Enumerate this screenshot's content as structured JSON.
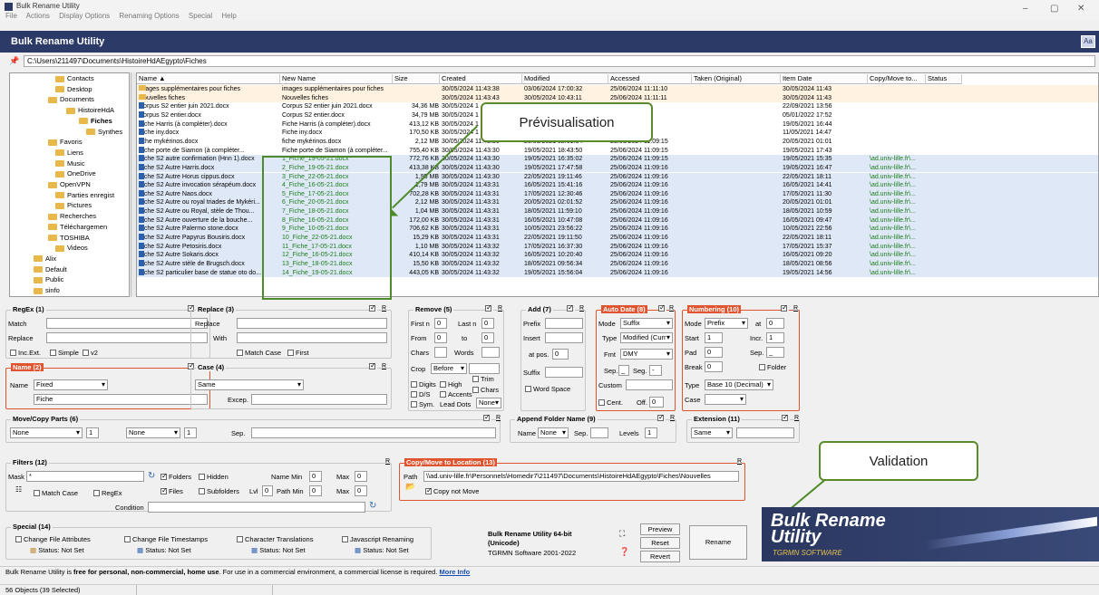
{
  "window": {
    "title": "Bulk Rename Utility",
    "controls": [
      "–",
      "▢",
      "✕"
    ]
  },
  "menu": [
    "File",
    "Actions",
    "Display Options",
    "Renaming Options",
    "Special",
    "Help"
  ],
  "header": {
    "title": "Bulk Rename Utility",
    "icon": "Aa"
  },
  "path": "C:\\Users\\211497\\Documents\\HistoireHdAEgypto\\Fiches",
  "tree": [
    {
      "label": "Contacts",
      "indent": 50
    },
    {
      "label": "Desktop",
      "indent": 50
    },
    {
      "label": "Documents",
      "indent": 42
    },
    {
      "label": "HistoireHdA",
      "indent": 62
    },
    {
      "label": "Fiches",
      "indent": 76,
      "bold": true
    },
    {
      "label": "Synthes",
      "indent": 84
    },
    {
      "label": "Favoris",
      "indent": 42
    },
    {
      "label": "Liens",
      "indent": 50
    },
    {
      "label": "Music",
      "indent": 50
    },
    {
      "label": "OneDrive",
      "indent": 50
    },
    {
      "label": "OpenVPN",
      "indent": 42
    },
    {
      "label": "Parties enregist",
      "indent": 50
    },
    {
      "label": "Pictures",
      "indent": 50
    },
    {
      "label": "Recherches",
      "indent": 42
    },
    {
      "label": "Téléchargemen",
      "indent": 42
    },
    {
      "label": "TOSHIBA",
      "indent": 42
    },
    {
      "label": "Videos",
      "indent": 50
    },
    {
      "label": "Alix",
      "indent": 26
    },
    {
      "label": "Default",
      "indent": 26
    },
    {
      "label": "Public",
      "indent": 26
    },
    {
      "label": "sinfo",
      "indent": 26
    }
  ],
  "columns": [
    "Name ▲",
    "New Name",
    "Size",
    "Created",
    "Modified",
    "Accessed",
    "Taken (Original)",
    "Item Date",
    "Copy/Move to...",
    "Status"
  ],
  "rows": [
    {
      "name": "images supplémentaires pour fiches",
      "new": "images supplémentaires pour fiches",
      "size": "",
      "created": "30/05/2024 11:43:38",
      "modified": "03/06/2024 17:00:32",
      "accessed": "25/06/2024 11:11:10",
      "itemdate": "30/05/2024 11:43",
      "copy": "",
      "folder": true,
      "style": "hl"
    },
    {
      "name": "Nouvelles fiches",
      "new": "Nouvelles fiches",
      "size": "",
      "created": "30/05/2024 11:43:43",
      "modified": "30/05/2024 10:43:11",
      "accessed": "25/06/2024 11:11:11",
      "itemdate": "30/05/2024 11:43",
      "copy": "",
      "folder": true,
      "style": "hl"
    },
    {
      "name": "Corpus S2 entier juin 2021.docx",
      "new": "Corpus S2 entier juin 2021.docx",
      "size": "34,36 MB",
      "created": "30/05/2024 1",
      "modified": "",
      "accessed": "09:14",
      "itemdate": "22/09/2021 13:56",
      "copy": "",
      "style": ""
    },
    {
      "name": "Corpus S2 entier.docx",
      "new": "Corpus S2 entier.docx",
      "size": "34,79 MB",
      "created": "30/05/2024 1",
      "modified": "",
      "accessed": "09:15",
      "itemdate": "05/01/2022 17:52",
      "copy": "",
      "style": ""
    },
    {
      "name": "Fiche Harris (à compléter).docx",
      "new": "Fiche Harris (à compléter).docx",
      "size": "413,12 KB",
      "created": "30/05/2024 1",
      "modified": "",
      "accessed": "09:15",
      "itemdate": "19/05/2021 16:44",
      "copy": "",
      "style": ""
    },
    {
      "name": "Fiche iny.docx",
      "new": "Fiche iny.docx",
      "size": "170,50 KB",
      "created": "30/05/2024 1",
      "modified": "",
      "accessed": "09:15",
      "itemdate": "11/05/2021 14:47",
      "copy": "",
      "style": ""
    },
    {
      "name": "fiche mykérinos.docx",
      "new": "fiche mykérinos.docx",
      "size": "2,12 MB",
      "created": "30/05/2024 11:43:30",
      "modified": "20/05/2021 02:01:34",
      "accessed": "25/06/2024 11:09:15",
      "itemdate": "20/05/2021 01:01",
      "copy": "",
      "style": ""
    },
    {
      "name": "Fiche porte de Siamon (à compléter...",
      "new": "Fiche porte de Siamon (à compléter...",
      "size": "755,40 KB",
      "created": "30/05/2024 11:43:30",
      "modified": "19/05/2021 18:43:50",
      "accessed": "25/06/2024 11:09:15",
      "itemdate": "19/05/2021 17:43",
      "copy": "",
      "style": ""
    },
    {
      "name": "Fiche S2 autre confirmation (Hnn 1).docx",
      "new": "1_Fiche_19-05-21.docx",
      "size": "772,76 KB",
      "created": "30/05/2024 11:43:30",
      "modified": "19/05/2021 16:35:02",
      "accessed": "25/06/2024 11:09:15",
      "itemdate": "19/05/2021 15:35",
      "copy": "\\ad.univ-lille.fr\\...",
      "style": "sel"
    },
    {
      "name": "Fiche S2 Autre Harris.docx",
      "new": "2_Fiche_19-05-21.docx",
      "size": "413,38 KB",
      "created": "30/05/2024 11:43:30",
      "modified": "19/05/2021 17:47:58",
      "accessed": "25/06/2024 11:09:16",
      "itemdate": "19/05/2021 16:47",
      "copy": "\\ad.univ-lille.fr\\...",
      "style": "sel"
    },
    {
      "name": "Fiche S2 Autre Horus cippus.docx",
      "new": "3_Fiche_22-05-21.docx",
      "size": "1,95 MB",
      "created": "30/05/2024 11:43:30",
      "modified": "22/05/2021 19:11:46",
      "accessed": "25/06/2024 11:09:16",
      "itemdate": "22/05/2021 18:11",
      "copy": "\\ad.univ-lille.fr\\...",
      "style": "sel"
    },
    {
      "name": "Fiche S2 Autre invocation sérapéum.docx",
      "new": "4_Fiche_16-05-21.docx",
      "size": "1,79 MB",
      "created": "30/05/2024 11:43:31",
      "modified": "16/05/2021 15:41:16",
      "accessed": "25/06/2024 11:09:16",
      "itemdate": "16/05/2021 14:41",
      "copy": "\\ad.univ-lille.fr\\...",
      "style": "sel"
    },
    {
      "name": "Fiche S2 Autre Naos.docx",
      "new": "5_Fiche_17-05-21.docx",
      "size": "702,28 KB",
      "created": "30/05/2024 11:43:31",
      "modified": "17/05/2021 12:30:46",
      "accessed": "25/06/2024 11:09:16",
      "itemdate": "17/05/2021 11:30",
      "copy": "\\ad.univ-lille.fr\\...",
      "style": "sel"
    },
    {
      "name": "Fiche S2 Autre ou royal triades de Mykéri...",
      "new": "6_Fiche_20-05-21.docx",
      "size": "2,12 MB",
      "created": "30/05/2024 11:43:31",
      "modified": "20/05/2021 02:01:52",
      "accessed": "25/06/2024 11:09:16",
      "itemdate": "20/05/2021 01:01",
      "copy": "\\ad.univ-lille.fr\\...",
      "style": "sel"
    },
    {
      "name": "Fiche S2 Autre ou Royal, stèle de Thou...",
      "new": "7_Fiche_18-05-21.docx",
      "size": "1,04 MB",
      "created": "30/05/2024 11:43:31",
      "modified": "18/05/2021 11:59:10",
      "accessed": "25/06/2024 11:09:16",
      "itemdate": "18/05/2021 10:59",
      "copy": "\\ad.univ-lille.fr\\...",
      "style": "sel"
    },
    {
      "name": "Fiche S2 Autre ouverture de la bouche...",
      "new": "8_Fiche_16-05-21.docx",
      "size": "172,00 KB",
      "created": "30/05/2024 11:43:31",
      "modified": "16/05/2021 10:47:08",
      "accessed": "25/06/2024 11:09:16",
      "itemdate": "16/05/2021 09:47",
      "copy": "\\ad.univ-lille.fr\\...",
      "style": "sel"
    },
    {
      "name": "Fiche S2 Autre Palermo stone.docx",
      "new": "9_Fiche_10-05-21.docx",
      "size": "706,62 KB",
      "created": "30/05/2024 11:43:31",
      "modified": "10/05/2021 23:56:22",
      "accessed": "25/06/2024 11:09:16",
      "itemdate": "10/05/2021 22:56",
      "copy": "\\ad.univ-lille.fr\\...",
      "style": "sel"
    },
    {
      "name": "Fiche S2 Autre Papyrus Bousiris.docx",
      "new": "10_Fiche_22-05-21.docx",
      "size": "15,29 KB",
      "created": "30/05/2024 11:43:31",
      "modified": "22/05/2021 19:11:50",
      "accessed": "25/06/2024 11:09:16",
      "itemdate": "22/05/2021 18:11",
      "copy": "\\ad.univ-lille.fr\\...",
      "style": "sel"
    },
    {
      "name": "Fiche S2 Autre Petosiris.docx",
      "new": "11_Fiche_17-05-21.docx",
      "size": "1,10 MB",
      "created": "30/05/2024 11:43:32",
      "modified": "17/05/2021 16:37:30",
      "accessed": "25/06/2024 11:09:16",
      "itemdate": "17/05/2021 15:37",
      "copy": "\\ad.univ-lille.fr\\...",
      "style": "sel"
    },
    {
      "name": "Fiche S2 Autre Sokaris.docx",
      "new": "12_Fiche_16-05-21.docx",
      "size": "410,14 KB",
      "created": "30/05/2024 11:43:32",
      "modified": "16/05/2021 10:20:40",
      "accessed": "25/06/2024 11:09:16",
      "itemdate": "16/05/2021 09:20",
      "copy": "\\ad.univ-lille.fr\\...",
      "style": "sel"
    },
    {
      "name": "Fiche S2 Autre stèle de Brugsch.docx",
      "new": "13_Fiche_18-05-21.docx",
      "size": "15,50 KB",
      "created": "30/05/2024 11:43:32",
      "modified": "18/05/2021 09:56:34",
      "accessed": "25/06/2024 11:09:16",
      "itemdate": "18/05/2021 08:56",
      "copy": "\\ad.univ-lille.fr\\...",
      "style": "sel"
    },
    {
      "name": "Fiche S2 particulier base de statue oto do...",
      "new": "14_Fiche_19-05-21.docx",
      "size": "443,05 KB",
      "created": "30/05/2024 11:43:32",
      "modified": "19/05/2021 15:56:04",
      "accessed": "25/06/2024 11:09:16",
      "itemdate": "19/05/2021 14:56",
      "copy": "\\ad.univ-lille.fr\\...",
      "style": "sel"
    }
  ],
  "callouts": {
    "preview": "Prévisualisation",
    "validate": "Validation"
  },
  "regex": {
    "title": "RegEx (1)",
    "match": "Match",
    "replace": "Replace",
    "incext": "Inc.Ext.",
    "simple": "Simple",
    "v2": "v2"
  },
  "replace": {
    "title": "Replace (3)",
    "replace": "Replace",
    "with": "With",
    "matchcase": "Match Case",
    "first": "First"
  },
  "name": {
    "title": "Name (2)",
    "label": "Name",
    "mode": "Fixed",
    "value": "Fiche"
  },
  "case": {
    "title": "Case (4)",
    "mode": "Same",
    "excep": "Excep."
  },
  "remove": {
    "title": "Remove (5)",
    "firstn": "First n",
    "lastn": "Last n",
    "from": "From",
    "to": "to",
    "chars": "Chars",
    "words": "Words",
    "crop": "Crop",
    "cropval": "Before",
    "digits": "Digits",
    "high": "High",
    "trim": "Trim",
    "ds": "D/S",
    "accents": "Accents",
    "chars2": "Chars",
    "sym": "Sym.",
    "leaddots": "Lead Dots",
    "none": "None",
    "zero": "0"
  },
  "add": {
    "title": "Add (7)",
    "prefix": "Prefix",
    "insert": "Insert",
    "atpos": "at pos.",
    "suffix": "Suffix",
    "wordspace": "Word Space",
    "zero": "0"
  },
  "autodate": {
    "title": "Auto Date (8)",
    "mode": "Mode",
    "modeval": "Suffix",
    "type": "Type",
    "typeval": "Modified (Curr",
    "fmt": "Fmt",
    "fmtval": "DMY",
    "sep": "Sep.",
    "sepval": "_",
    "seg": "Seg.",
    "segval": "-",
    "custom": "Custom",
    "cent": "Cent.",
    "off": "Off.",
    "zero": "0"
  },
  "numbering": {
    "title": "Numbering (10)",
    "mode": "Mode",
    "modeval": "Prefix",
    "at": "at",
    "atval": "0",
    "start": "Start",
    "startval": "1",
    "incr": "Incr.",
    "incrval": "1",
    "pad": "Pad",
    "padval": "0",
    "sep": "Sep.",
    "sepval": "_",
    "break": "Break",
    "breakval": "0",
    "folder": "Folder",
    "type": "Type",
    "typeval": "Base 10 (Decimal)",
    "case": "Case"
  },
  "movecopy": {
    "title": "Move/Copy Parts (6)",
    "a": "None",
    "b": "1",
    "c": "None",
    "d": "1",
    "sep": "Sep."
  },
  "appendfolder": {
    "title": "Append Folder Name (9)",
    "name": "Name",
    "nameval": "None",
    "sep": "Sep.",
    "levels": "Levels",
    "levelsval": "1"
  },
  "extension": {
    "title": "Extension (11)",
    "val": "Same"
  },
  "filters": {
    "title": "Filters (12)",
    "mask": "Mask",
    "maskval": "*",
    "folders": "Folders",
    "hidden": "Hidden",
    "files": "Files",
    "subfolders": "Subfolders",
    "lvl": "Lvl",
    "lvlval": "0",
    "namemin": "Name Min",
    "max": "Max",
    "pathmin": "Path Min",
    "zero": "0",
    "matchcase": "Match Case",
    "regex": "RegEx",
    "condition": "Condition"
  },
  "copymove": {
    "title": "Copy/Move to Location (13)",
    "path": "Path",
    "pathval": "\\\\ad.univ-lille.fr\\Personnels\\Homedir7\\211497\\Documents\\HistoireHdAEgypto\\Fiches\\Nouvelles",
    "copynotmove": "Copy not Move"
  },
  "special": {
    "title": "Special (14)",
    "items": [
      {
        "label": "Change File Attributes",
        "status": "Status: Not Set"
      },
      {
        "label": "Change File Timestamps",
        "status": "Status: Not Set"
      },
      {
        "label": "Character Translations",
        "status": "Status: Not Set"
      },
      {
        "label": "Javascript Renaming",
        "status": "Status: Not Set"
      }
    ]
  },
  "about": {
    "l1": "Bulk Rename Utility 64-bit",
    "l2": "(Unicode)",
    "l3": "TGRMN Software 2001-2022"
  },
  "buttons": {
    "preview": "Preview",
    "reset": "Reset",
    "revert": "Revert",
    "rename": "Rename"
  },
  "logo": {
    "l1": "Bulk Rename",
    "l2": "Utility",
    "l3": "TGRMN SOFTWARE"
  },
  "infobar": {
    "pre": "Bulk Rename Utility is ",
    "bold": "free for personal, non-commercial, home use",
    "post": ". For use in a commercial environment, a commercial license is required. ",
    "link": "More Info"
  },
  "status": "56 Objects (39 Selected)",
  "r": "R"
}
